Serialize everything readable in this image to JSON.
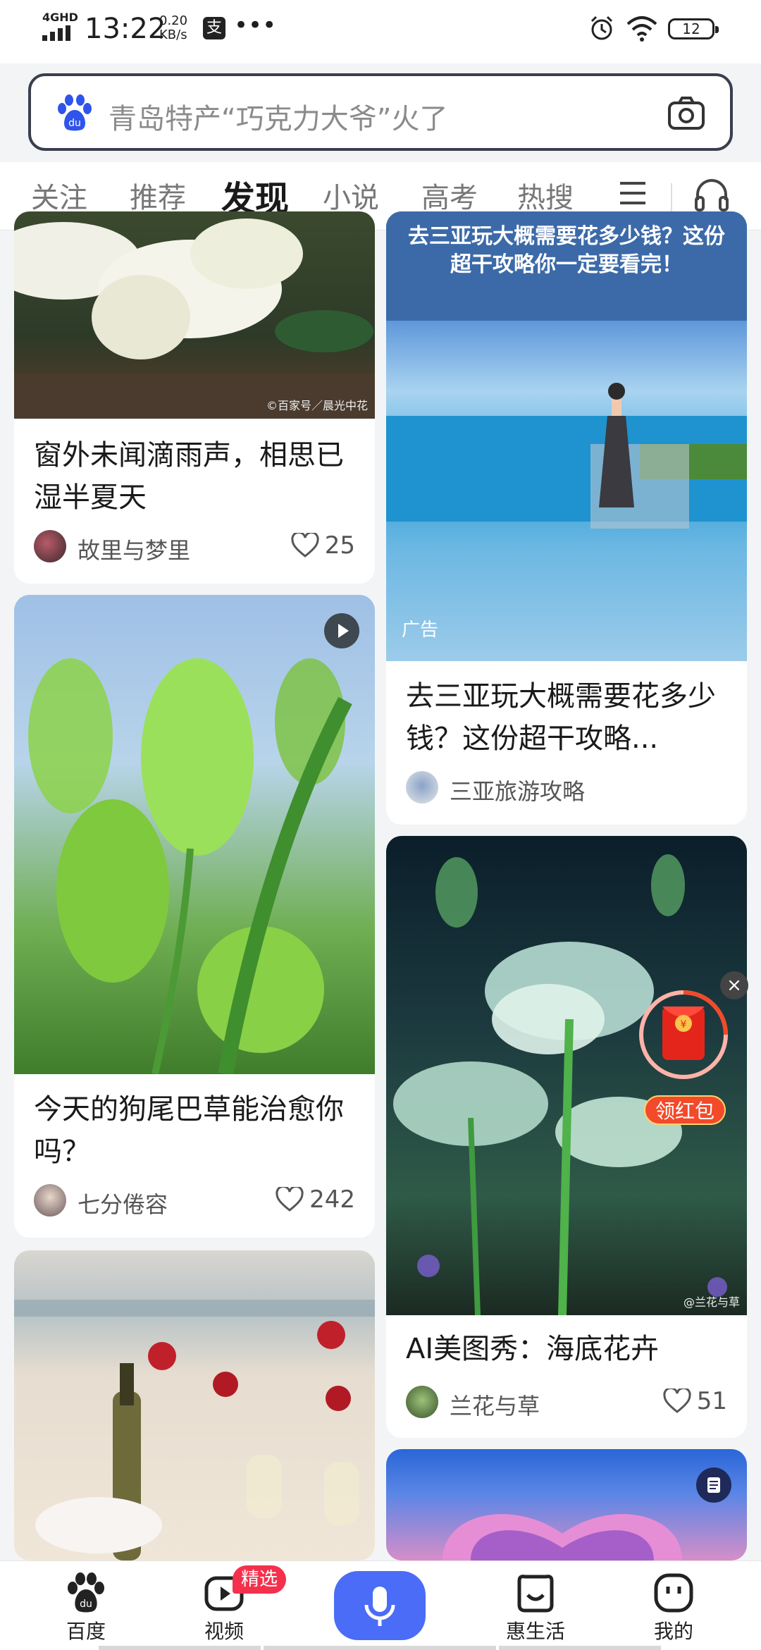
{
  "status_bar": {
    "network": "4GHD",
    "time": "13:22",
    "speed_value": "0.20",
    "speed_unit": "KB/s",
    "alipay_glyph": "支",
    "more": "•••",
    "battery": "12"
  },
  "search": {
    "placeholder": "青岛特产“巧克力大爷”火了",
    "logo_text": "du"
  },
  "tabs": [
    "关注",
    "推荐",
    "发现",
    "小说",
    "高考",
    "热搜"
  ],
  "active_tab": "发现",
  "feed": {
    "left": [
      {
        "title": "窗外未闻滴雨声，相思已湿半夏天",
        "author": "故里与梦里",
        "likes": "25",
        "watermark": "©百家号／晨光中花"
      },
      {
        "title": "今天的狗尾巴草能治愈你吗？",
        "author": "七分倦容",
        "likes": "242"
      },
      {
        "title": ""
      }
    ],
    "right": [
      {
        "overlay_text": "去三亚玩大概需要花多少钱？这份超干攻略你一定要看完！",
        "ad_tag": "广告",
        "title": "去三亚玩大概需要花多少钱？这份超干攻略...",
        "author": "三亚旅游攻略"
      },
      {
        "title": "AI美图秀：海底花卉",
        "author": "兰花与草",
        "likes": "51",
        "watermark": "@兰花与草"
      }
    ]
  },
  "red_packet": {
    "label": "领红包",
    "symbol": "¥",
    "close": "×"
  },
  "bottom_nav": [
    {
      "label": "百度",
      "icon": "baidu-paw-icon"
    },
    {
      "label": "视频",
      "icon": "video-play-icon",
      "badge": "精选"
    },
    {
      "label": "",
      "icon": "microphone-icon"
    },
    {
      "label": "惠生活",
      "icon": "smile-box-icon"
    },
    {
      "label": "我的",
      "icon": "profile-face-icon"
    }
  ],
  "colors": {
    "accent": "#3c5cf8",
    "mic": "#4a6cf7",
    "badge": "#f4304c",
    "red_packet": "#f24a2a"
  }
}
